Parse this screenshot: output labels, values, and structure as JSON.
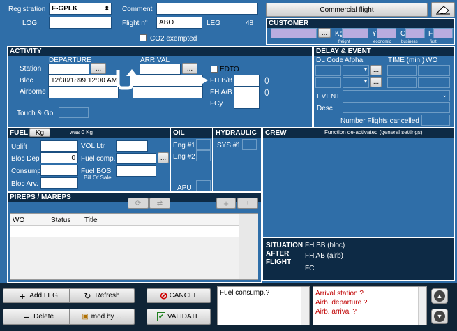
{
  "header": {
    "registration_label": "Registration",
    "registration_value": "F-GPLK",
    "comment_label": "Comment",
    "comment_value": "",
    "log_label": "LOG",
    "log_value": "",
    "flight_no_label": "Flight n°",
    "flight_no_value": "ABO",
    "leg_label": "LEG",
    "leg_value": "48",
    "co2_label": "CO2 exempted",
    "commercial_flight_label": "Commercial flight"
  },
  "customer": {
    "title": "CUSTOMER",
    "kg_label": "Kg",
    "y_label": "Y",
    "c_label": "C",
    "f_label": "F",
    "freight_label": "freight",
    "economic_label": "economic",
    "business_label": "business",
    "first_label": "first"
  },
  "activity": {
    "title": "ACTIVITY",
    "departure_label": "DEPARTURE",
    "arrival_label": "ARRIVAL",
    "station_label": "Station",
    "bloc_label": "Bloc",
    "bloc_value": "12/30/1899 12:00 AM",
    "airborne_label": "Airborne",
    "edto_label": "EDTO",
    "fh_bb_label": "FH B/B",
    "fh_ab_label": "FH A/B",
    "fcy_label": "FCy",
    "fh_bb_suffix": "()",
    "fh_ab_suffix": "()",
    "touch_go_label": "Touch & Go"
  },
  "delay": {
    "title": "DELAY & EVENT",
    "dl_code_label": "DL Code",
    "alpha_label": "Afpha",
    "time_label": "TIME (min.)",
    "wo_label": "WO",
    "event_label": "EVENT",
    "desc_label": "Desc",
    "flights_cancelled_label": "Number Flights cancelled"
  },
  "fuel": {
    "title": "FUEL",
    "unit_button": "Kg",
    "was_label": "was 0 Kg",
    "uplift_label": "Uplift",
    "bloc_dep_label": "Bloc Dep.",
    "bloc_dep_value": "0",
    "consump_label": "Consump.",
    "bloc_arv_label": "Bloc Arv.",
    "vol_label": "VOL Ltr",
    "fuel_comp_label": "Fuel comp.",
    "fuel_bos_label": "Fuel BOS",
    "bill_of_sale_label": "Bill Of Sale"
  },
  "oil": {
    "title": "OIL",
    "eng1_label": "Eng #1",
    "eng2_label": "Eng #2",
    "apu_label": "APU"
  },
  "hydraulic": {
    "title": "HYDRAULIC",
    "sys1_label": "SYS #1"
  },
  "crew": {
    "title": "CREW",
    "note": "Function de-activated (general settings)"
  },
  "pireps": {
    "title": "PIREPS / MAREPS",
    "columns": [
      "WO",
      "Status",
      "Title"
    ]
  },
  "situation": {
    "title_line1": "SITUATION",
    "title_line2": "AFTER",
    "title_line3": "FLIGHT",
    "fh_bb_label": "FH BB (bloc)",
    "fh_ab_label": "FH AB (airb)",
    "fc_label": "FC"
  },
  "footer": {
    "add_leg_label": "Add LEG",
    "refresh_label": "Refresh",
    "cancel_label": "CANCEL",
    "delete_label": "Delete",
    "mod_by_label": "mod by ...",
    "validate_label": "VALIDATE",
    "fuel_note": "Fuel consump.?",
    "warnings": [
      "Arrival station ?",
      "Airb. departure ?",
      "Airb. arrival ?"
    ]
  },
  "colors": {
    "background": "#2f6ea8",
    "title_bar": "#0d2a45",
    "warning_text": "#c00000",
    "bottom_bar": "#0f2436"
  }
}
